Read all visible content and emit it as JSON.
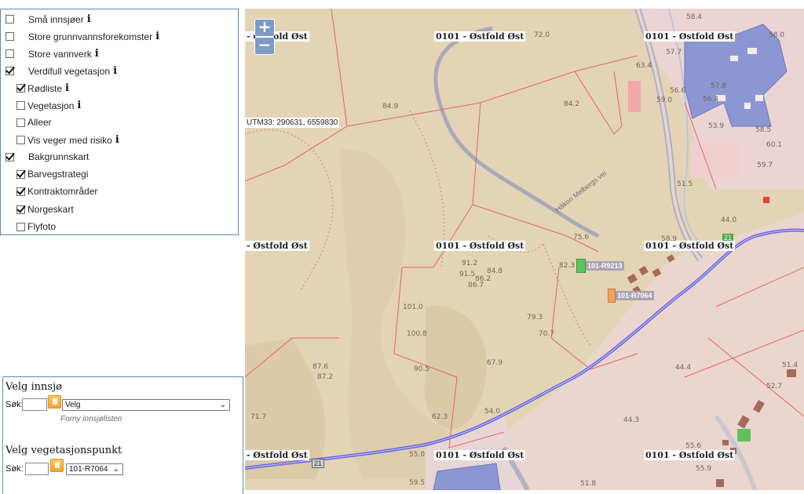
{
  "layers": [
    {
      "label": "Små innsjøer",
      "checked": false,
      "info": "i"
    },
    {
      "label": "Store grunnvannsforekomster",
      "checked": false,
      "info": "i"
    },
    {
      "label": "Store vannverk",
      "checked": false,
      "info": "i"
    },
    {
      "label": "Verdifull vegetasjon",
      "checked": true,
      "info": "i"
    },
    {
      "label": "Rødliste",
      "checked": true,
      "info": "i"
    },
    {
      "label": "Vegetasjon",
      "checked": false,
      "info": "i"
    },
    {
      "label": "Alleer",
      "checked": false
    },
    {
      "label": "Vis veger med risiko",
      "checked": false,
      "info": "i"
    },
    {
      "label": "Bakgrunnskart",
      "checked": true
    },
    {
      "label": "Barvegstrategi",
      "checked": true
    },
    {
      "label": "Kontraktområder",
      "checked": true
    },
    {
      "label": "Norgeskart",
      "checked": true
    },
    {
      "label": "Flyfoto",
      "checked": false
    }
  ],
  "lake_panel": {
    "title": "Velg innsjø",
    "search_label": "Søk:",
    "select_value": "Velg",
    "refresh_link": "Forny innsjølisten"
  },
  "veg_panel": {
    "title": "Velg vegetasjonspunkt",
    "search_label": "Søk:",
    "select_value": "101-R7064"
  },
  "map": {
    "zoom_in": "+",
    "zoom_out": "−",
    "utm_readout": "UTM33: 290631, 6559830",
    "area_labels": [
      "- Østfold Øst",
      "0101 - Østfold Øst",
      "0101 - Østfold Øst",
      "- Østfold Øst",
      "0101 - Østfold Øst",
      "0101 - Østfold Øst",
      "- Østfold Øst",
      "0101 - Østfold Øst",
      "0101 - Østfold Øst"
    ],
    "markers": [
      {
        "label": "101-R9213",
        "color": "#5cc35c"
      },
      {
        "label": "101-R7064",
        "color": "#f0a25a"
      }
    ],
    "road_labels": [
      "21",
      "21"
    ],
    "street_label": "Håkon Melbergs vei",
    "elevations": [
      "58.4",
      "72.0",
      "84.9",
      "84.2",
      "63.4",
      "57.7",
      "58.0",
      "56.6",
      "57.8",
      "56.4",
      "59.0",
      "53.9",
      "58.5",
      "60.1",
      "59.7",
      "51.5",
      "44.0",
      "58.9",
      "75.6",
      "82.3",
      "91.2",
      "84.8",
      "91.5",
      "86.2",
      "86.7",
      "101.0",
      "100.8",
      "79.3",
      "70.7",
      "87.6",
      "87.2",
      "90.5",
      "67.9",
      "71.7",
      "62.3",
      "54.0",
      "44.4",
      "51.4",
      "52.7",
      "44.3",
      "55.0",
      "55.6",
      "55.9",
      "59.5",
      "51.8"
    ],
    "colors": {
      "terrain": "#e4d4b6",
      "boundary": "#e06060",
      "road": "#6464e6",
      "building": "#8c96d2"
    }
  }
}
